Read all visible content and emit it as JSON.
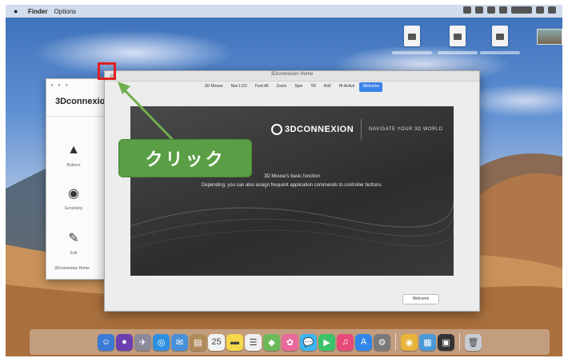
{
  "menubar": {
    "app_name": "Finder",
    "menu_item": "Options"
  },
  "back_window": {
    "brand": "3Dconnexion",
    "items": [
      {
        "label": "Buttons",
        "icon": "mouse-icon"
      },
      {
        "label": "Sensitivity",
        "icon": "eye-icon"
      },
      {
        "label": "Edit",
        "icon": "pen-icon"
      }
    ],
    "footer": "3Dconnexion Home"
  },
  "main_window": {
    "title": "3Dconnexion Home",
    "tabs": [
      "3D Mouse",
      "Nav LCD",
      "Font All",
      "Zoom",
      "Spin",
      "Tilt",
      "Roll",
      "Hi-Active",
      "Welcome"
    ],
    "active_tab": "Welcome",
    "logo_text": "3DCONNEXION",
    "tagline": "NAVIGATE YOUR 3D WORLD",
    "desc_line1": "3D Mouse's basic function",
    "desc_line2": "Depending, you can also assign frequent application commands to controller buttons.",
    "button_label": "Welcome"
  },
  "annotation": {
    "callout_text": "クリック",
    "accent_color": "#5a9e45",
    "highlight_color": "#e02020"
  },
  "dock": {
    "icons": [
      {
        "name": "finder-icon",
        "color": "#3a7bd5",
        "glyph": "☺"
      },
      {
        "name": "siri-icon",
        "color": "#6b3fb0",
        "glyph": "●"
      },
      {
        "name": "launchpad-icon",
        "color": "#8a8a9a",
        "glyph": "✈"
      },
      {
        "name": "safari-icon",
        "color": "#2e8fe0",
        "glyph": "◎"
      },
      {
        "name": "mail-icon",
        "color": "#4a90d9",
        "glyph": "✉"
      },
      {
        "name": "contacts-icon",
        "color": "#b08a5a",
        "glyph": "▤"
      },
      {
        "name": "calendar-icon",
        "color": "#f2f2f2",
        "glyph": "25"
      },
      {
        "name": "notes-icon",
        "color": "#f5d84a",
        "glyph": "▬"
      },
      {
        "name": "reminders-icon",
        "color": "#f0f0f0",
        "glyph": "☰"
      },
      {
        "name": "maps-icon",
        "color": "#6cba5a",
        "glyph": "◆"
      },
      {
        "name": "photos-icon",
        "color": "#e86a9a",
        "glyph": "✿"
      },
      {
        "name": "messages-icon",
        "color": "#3cb4f0",
        "glyph": "💬"
      },
      {
        "name": "facetime-icon",
        "color": "#3cc36a",
        "glyph": "▶"
      },
      {
        "name": "music-icon",
        "color": "#e84a7a",
        "glyph": "♫"
      },
      {
        "name": "app-store-icon",
        "color": "#2f86e8",
        "glyph": "A"
      },
      {
        "name": "system-preferences-icon",
        "color": "#7a7a7a",
        "glyph": "⚙"
      },
      {
        "name": "chrome-icon",
        "color": "#e8b43a",
        "glyph": "◉"
      },
      {
        "name": "finder-window-icon",
        "color": "#4a9ad6",
        "glyph": "▦"
      },
      {
        "name": "3dconnexion-icon",
        "color": "#333333",
        "glyph": "▣"
      },
      {
        "name": "trash-icon",
        "color": "#c8ccd2",
        "glyph": "🗑"
      }
    ]
  }
}
